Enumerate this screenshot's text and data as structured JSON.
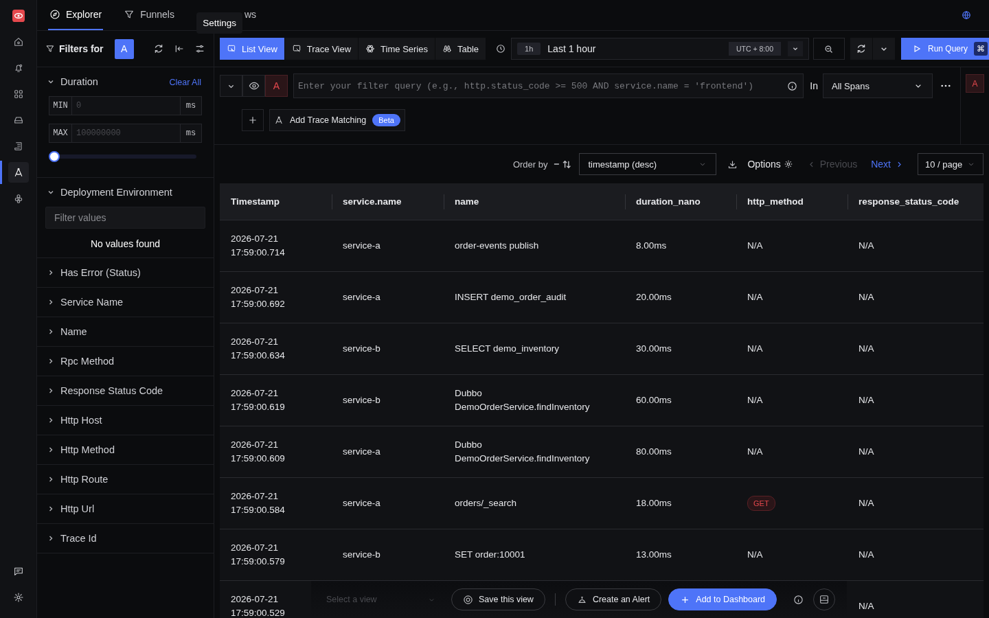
{
  "nav_tabs": [
    {
      "label": "Explorer",
      "selected": true
    },
    {
      "label": "Funnels",
      "selected": false
    },
    {
      "label": "ws",
      "selected": false
    }
  ],
  "tooltip": "Settings",
  "rail": [
    {
      "selected": false
    },
    {
      "selected": false
    },
    {
      "selected": false
    },
    {
      "selected": false
    },
    {
      "selected": false
    },
    {
      "selected": true
    },
    {
      "selected": false
    }
  ],
  "filters": {
    "title": "Filters for",
    "query_badge": "A",
    "clear_all": "Clear All",
    "sections": [
      {
        "kind": "range",
        "title": "Duration",
        "expanded": true,
        "min_label": "MIN",
        "min_placeholder": "0",
        "min_unit": "ms",
        "max_label": "MAX",
        "max_placeholder": "100000000",
        "max_unit": "ms",
        "level": 0
      },
      {
        "kind": "values",
        "title": "Deployment Environment",
        "expanded": true,
        "placeholder": "Filter values",
        "empty": "No values found"
      },
      {
        "title": "Has Error (Status)",
        "expanded": false
      },
      {
        "title": "Service Name",
        "expanded": false
      },
      {
        "title": "Name",
        "expanded": false
      },
      {
        "title": "Rpc Method",
        "expanded": false
      },
      {
        "title": "Response Status Code",
        "expanded": false
      },
      {
        "title": "Http Host",
        "expanded": false
      },
      {
        "title": "Http Method",
        "expanded": false
      },
      {
        "title": "Http Route",
        "expanded": false
      },
      {
        "title": "Http Url",
        "expanded": false
      },
      {
        "title": "Trace Id",
        "expanded": false
      }
    ]
  },
  "view_tabs": [
    {
      "label": "List View",
      "selected": true
    },
    {
      "label": "Trace View",
      "selected": false
    },
    {
      "label": "Time Series",
      "selected": false
    },
    {
      "label": "Table",
      "selected": false
    }
  ],
  "time": {
    "badge": "1h",
    "label": "Last 1 hour",
    "timezone": "UTC + 8:00"
  },
  "run_button": {
    "label": "Run Query",
    "shortcut": "⌘"
  },
  "query": {
    "label": "A",
    "placeholder": "Enter your filter query (e.g., http.status_code >= 500 AND service.name = 'frontend')",
    "in_label": "In",
    "scope": "All Spans",
    "side_badge": "A"
  },
  "trace_matching": {
    "label": "Add Trace Matching",
    "badge": "Beta"
  },
  "order": {
    "label": "Order by",
    "value": "timestamp (desc)",
    "options": "Options",
    "previous": {
      "label": "Previous",
      "disabled": true
    },
    "next": {
      "label": "Next",
      "disabled": false
    },
    "page_size": "10 / page"
  },
  "table": {
    "columns": [
      "Timestamp",
      "service.name",
      "name",
      "duration_nano",
      "http_method",
      "response_status_code"
    ],
    "rows": [
      {
        "timestamp": "2026-07-21 17:59:00.714",
        "service_name": "service-a",
        "name": "order-events publish",
        "duration_nano": "8.00ms",
        "http_method": "N/A",
        "method_badge": false,
        "response_status_code": "N/A"
      },
      {
        "timestamp": "2026-07-21 17:59:00.692",
        "service_name": "service-a",
        "name": "INSERT demo_order_audit",
        "duration_nano": "20.00ms",
        "http_method": "N/A",
        "method_badge": false,
        "response_status_code": "N/A"
      },
      {
        "timestamp": "2026-07-21 17:59:00.634",
        "service_name": "service-b",
        "name": "SELECT demo_inventory",
        "duration_nano": "30.00ms",
        "http_method": "N/A",
        "method_badge": false,
        "response_status_code": "N/A"
      },
      {
        "timestamp": "2026-07-21 17:59:00.619",
        "service_name": "service-b",
        "name": "Dubbo DemoOrderService.findInventory",
        "duration_nano": "60.00ms",
        "http_method": "N/A",
        "method_badge": false,
        "response_status_code": "N/A"
      },
      {
        "timestamp": "2026-07-21 17:59:00.609",
        "service_name": "service-a",
        "name": "Dubbo DemoOrderService.findInventory",
        "duration_nano": "80.00ms",
        "http_method": "N/A",
        "method_badge": false,
        "response_status_code": "N/A"
      },
      {
        "timestamp": "2026-07-21 17:59:00.584",
        "service_name": "service-a",
        "name": "orders/_search",
        "duration_nano": "18.00ms",
        "http_method": "GET",
        "method_badge": true,
        "response_status_code": "N/A"
      },
      {
        "timestamp": "2026-07-21 17:59:00.579",
        "service_name": "service-b",
        "name": "SET order:10001",
        "duration_nano": "13.00ms",
        "http_method": "N/A",
        "method_badge": false,
        "response_status_code": "N/A"
      },
      {
        "timestamp": "2026-07-21 17:59:00.529",
        "response_status_code": "N/A"
      }
    ]
  },
  "bottom_bar": {
    "view_placeholder": "Select a view",
    "save": "Save this view",
    "alert": "Create an Alert",
    "dashboard": "Add to Dashboard"
  }
}
